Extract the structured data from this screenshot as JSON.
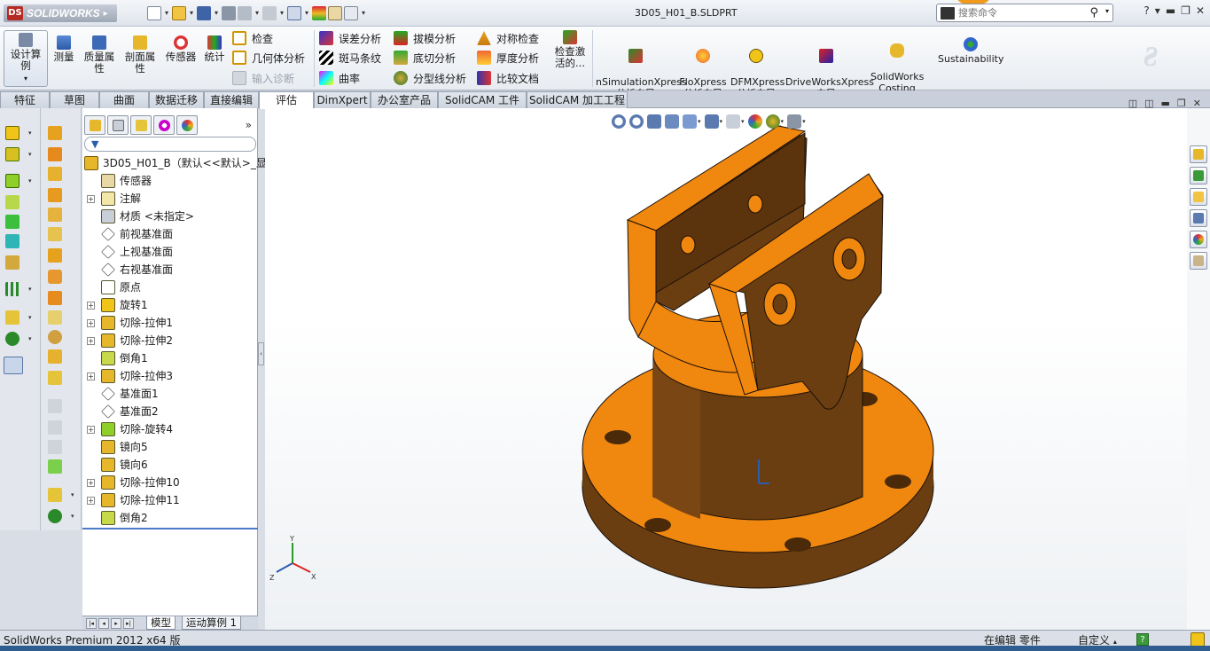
{
  "app": {
    "logo_text": "SOLIDWORKS",
    "document_title": "3D05_H01_B.SLDPRT",
    "search_placeholder": "搜索命令",
    "help_label": "?"
  },
  "ribbon": {
    "design_study": "设计算例",
    "measure": "测量",
    "mass_props": "质量属性",
    "section_props": "剖面属性",
    "sensors": "传感器",
    "statistics": "统计",
    "check": "检查",
    "geometry_analysis": "几何体分析",
    "import_diag": "输入诊断",
    "deviation": "误差分析",
    "zebra": "斑马条纹",
    "curvature": "曲率",
    "draft": "拔模分析",
    "undercut": "底切分析",
    "parting": "分型线分析",
    "symmetry": "对称检查",
    "thickness": "厚度分析",
    "compare": "比较文档",
    "check_active": "检查激活的...",
    "simxpress": "nSimulationXpress\n分析向导",
    "floxpress": "FloXpress\n分析向导",
    "dfmxpress": "DFMXpress\n分析向导",
    "driveworks": "DriveWorksXpress\n向导",
    "costing": "SolidWorks\nCosting",
    "sustainability": "Sustainability"
  },
  "tabs": [
    {
      "label": "特征"
    },
    {
      "label": "草图"
    },
    {
      "label": "曲面"
    },
    {
      "label": "数据迁移"
    },
    {
      "label": "直接编辑"
    },
    {
      "label": "评估"
    },
    {
      "label": "DimXpert"
    },
    {
      "label": "办公室产品"
    },
    {
      "label": "SolidCAM 工件"
    },
    {
      "label": "SolidCAM 加工工程"
    }
  ],
  "tree": {
    "root": "3D05_H01_B（默认<<默认>_显",
    "items": [
      {
        "label": "传感器",
        "icon": "sensor-icon",
        "expand": false
      },
      {
        "label": "注解",
        "icon": "annotation-icon",
        "expand": true
      },
      {
        "label": "材质 <未指定>",
        "icon": "material-icon",
        "expand": false
      },
      {
        "label": "前视基准面",
        "icon": "plane-icon",
        "expand": false
      },
      {
        "label": "上视基准面",
        "icon": "plane-icon",
        "expand": false
      },
      {
        "label": "右视基准面",
        "icon": "plane-icon",
        "expand": false
      },
      {
        "label": "原点",
        "icon": "origin-icon",
        "expand": false
      },
      {
        "label": "旋转1",
        "icon": "revolve-icon",
        "expand": true
      },
      {
        "label": "切除-拉伸1",
        "icon": "cut-extrude-icon",
        "expand": true
      },
      {
        "label": "切除-拉伸2",
        "icon": "cut-extrude-icon",
        "expand": true
      },
      {
        "label": "倒角1",
        "icon": "chamfer-icon",
        "expand": false
      },
      {
        "label": "切除-拉伸3",
        "icon": "cut-extrude-icon",
        "expand": true
      },
      {
        "label": "基准面1",
        "icon": "plane-icon",
        "expand": false
      },
      {
        "label": "基准面2",
        "icon": "plane-icon",
        "expand": false
      },
      {
        "label": "切除-旋转4",
        "icon": "cut-revolve-icon",
        "expand": true
      },
      {
        "label": "镜向5",
        "icon": "mirror-icon",
        "expand": false
      },
      {
        "label": "镜向6",
        "icon": "mirror-icon",
        "expand": false
      },
      {
        "label": "切除-拉伸10",
        "icon": "cut-extrude-icon",
        "expand": true
      },
      {
        "label": "切除-拉伸11",
        "icon": "cut-extrude-icon",
        "expand": true
      },
      {
        "label": "倒角2",
        "icon": "chamfer-icon",
        "expand": false
      }
    ]
  },
  "bottom_tabs": {
    "model": "模型",
    "motion": "运动算例 1"
  },
  "triad": {
    "x": "X",
    "y": "Y",
    "z": "Z"
  },
  "status": {
    "product": "SolidWorks Premium 2012 x64 版",
    "editing": "在编辑 零件",
    "units": "自定义"
  },
  "colors": {
    "part_orange": "#f0870f",
    "part_brown": "#6b3e12",
    "accent_blue": "#2a5dae"
  }
}
